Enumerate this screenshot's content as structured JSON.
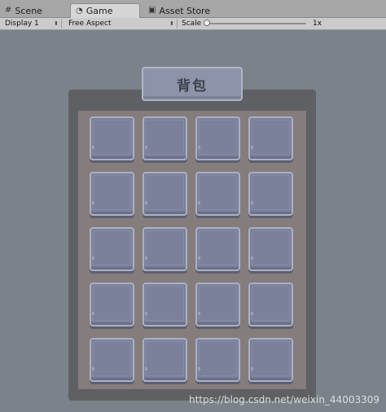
{
  "tabs": [
    {
      "label": "Scene",
      "icon": "hash-grid-icon",
      "active": false
    },
    {
      "label": "Game",
      "icon": "pacman-icon",
      "active": true
    },
    {
      "label": "Asset Store",
      "icon": "shopping-bag-icon",
      "active": false
    }
  ],
  "toolbar": {
    "display": "Display 1",
    "aspect": "Free Aspect",
    "scale_label": "Scale",
    "scale_value": "1x",
    "scale_fraction": 0.0
  },
  "game": {
    "bag_title": "背包",
    "slot_rows": 5,
    "slot_cols": 4
  },
  "watermark": "https://blog.csdn.net/weixin_44003309",
  "colors": {
    "background": "#7c8289",
    "panel": "#5e6064",
    "inner_panel": "#857d7c",
    "slot": "#7b819a",
    "title_plate": "#8d93a8"
  }
}
